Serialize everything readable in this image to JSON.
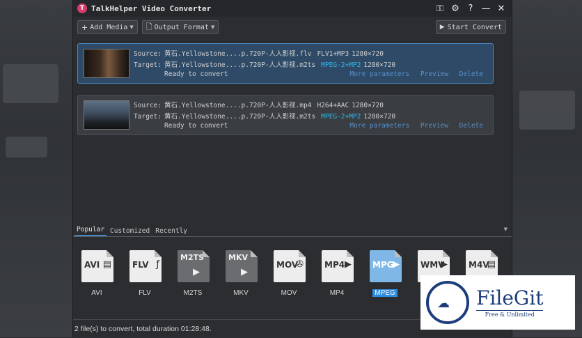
{
  "window": {
    "title": "TalkHelper Video Converter",
    "icons": [
      "key-icon",
      "gear-icon",
      "help-icon",
      "minimize-icon",
      "close-icon"
    ],
    "icon_glyphs": [
      "⚿",
      "⚙",
      "?",
      "—",
      "✕"
    ]
  },
  "toolbar": {
    "add_media": "Add Media",
    "output_format": "Output Format",
    "start_convert": "Start Convert"
  },
  "files": [
    {
      "source_label": "Source:",
      "source_name": "黄石.Yellowstone....p.720P-人人影视.flv",
      "source_codec": "FLV1+MP3",
      "source_res": "1280×720",
      "target_label": "Target:",
      "target_name": "黄石.Yellowstone....p.720P-人人影视.m2ts",
      "target_codec": "MPEG-2+MP2",
      "target_res": "1280×720",
      "status": "Ready to convert",
      "more": "More parameters",
      "preview": "Preview",
      "delete": "Delete"
    },
    {
      "source_label": "Source:",
      "source_name": "黄石.Yellowstone....p.720P-人人影视.mp4",
      "source_codec": "H264+AAC",
      "source_res": "1280×720",
      "target_label": "Target:",
      "target_name": "黄石.Yellowstone....p.720P-人人影视.m2ts",
      "target_codec": "MPEG-2+MP2",
      "target_res": "1280×720",
      "status": "Ready to convert",
      "more": "More parameters",
      "preview": "Preview",
      "delete": "Delete"
    }
  ],
  "format_tabs": [
    "Popular",
    "Customized",
    "Recently"
  ],
  "formats": [
    {
      "badge": "AVI",
      "name": "AVI",
      "icon": "avi-file-icon",
      "glyph": "▤"
    },
    {
      "badge": "FLV",
      "name": "FLV",
      "icon": "flv-file-icon",
      "glyph": "ƒ"
    },
    {
      "badge": "M2TS",
      "name": "M2TS",
      "icon": "m2ts-file-icon",
      "glyph": "▶"
    },
    {
      "badge": "MKV",
      "name": "MKV",
      "icon": "mkv-file-icon",
      "glyph": "▶"
    },
    {
      "badge": "MOV",
      "name": "MOV",
      "icon": "mov-file-icon",
      "glyph": "✇"
    },
    {
      "badge": "MP4",
      "name": "MP4",
      "icon": "mp4-file-icon",
      "glyph": "▶"
    },
    {
      "badge": "MPG",
      "name": "MPEG",
      "icon": "mpeg-file-icon",
      "glyph": "▶"
    },
    {
      "badge": "WMV",
      "name": "",
      "icon": "wmv-file-icon",
      "glyph": "▶"
    },
    {
      "badge": "M4V",
      "name": "",
      "icon": "m4v-file-icon",
      "glyph": "▤"
    }
  ],
  "status": "2 file(s) to convert, total duration 01:28:48.",
  "watermark": {
    "name": "FileGit",
    "tagline": "Free & Unlimited"
  },
  "colors": {
    "selection_blue": "#2f8de0",
    "accent_cyan": "#2fb8ea",
    "link_blue": "#5a8fc9"
  }
}
